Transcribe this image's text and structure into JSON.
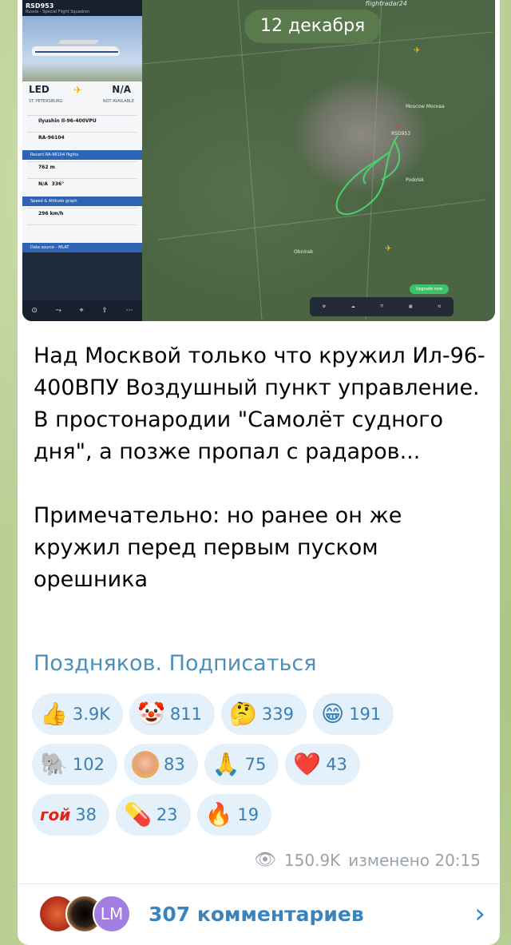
{
  "media": {
    "date_pill": "12 декабря",
    "fr24": {
      "flight": "RSD953",
      "subtitle": "Russia - Special Flight Squadron",
      "logo": "flightradar24",
      "from_code": "LED",
      "to_code": "N/A",
      "from_city": "ST. PETERSBURG",
      "to_city": "NOT AVAILABLE",
      "aircraft_type": "Ilyushin Il-96-400VPU",
      "registration": "RA-96104",
      "recent_bar": "Recent RA-96104 flights",
      "baro_alt": "762 m",
      "gps_alt": "N/A",
      "track": "336°",
      "speed_bar": "Speed & Altitude graph",
      "ground_speed": "296 km/h",
      "data_bar": "Data source - MLAT",
      "toolbar": [
        "3D view",
        "Route",
        "Follow",
        "Share",
        "More"
      ],
      "map_labels": [
        "Moscow\nМосква",
        "RSD953",
        "Podolsk",
        "Obninsk"
      ],
      "map_tools": [
        "Settings",
        "Weather",
        "Filters",
        "Widgets",
        "Playback"
      ],
      "upgrade": "Upgrade now"
    }
  },
  "post": {
    "text": "Над Москвой только что кружил Ил-96-400ВПУ Воздушный пункт управление. В простонародии \"Самолёт судного дня\", а позже пропал с радаров...\n\nПримечательно: но ранее он же кружил перед первым пуском орешника",
    "signature": "Поздняков. Подписаться"
  },
  "reactions": [
    [
      {
        "emoji": "👍",
        "count": "3.9K"
      },
      {
        "emoji": "🤡",
        "count": "811"
      },
      {
        "emoji": "🤔",
        "count": "339"
      },
      {
        "emoji": "😁",
        "count": "191"
      }
    ],
    [
      {
        "emoji": "🐘",
        "count": "102"
      },
      {
        "emoji": "face",
        "count": "83"
      },
      {
        "emoji": "🙏",
        "count": "75"
      },
      {
        "emoji": "❤️",
        "count": "43"
      }
    ],
    [
      {
        "emoji": "гой",
        "count": "38"
      },
      {
        "emoji": "💊",
        "count": "23"
      },
      {
        "emoji": "🔥",
        "count": "19"
      }
    ]
  ],
  "meta": {
    "views": "150.9K",
    "edited": "изменено 20:15"
  },
  "comments": {
    "avatar3_initials": "LM",
    "label": "307 комментариев"
  }
}
